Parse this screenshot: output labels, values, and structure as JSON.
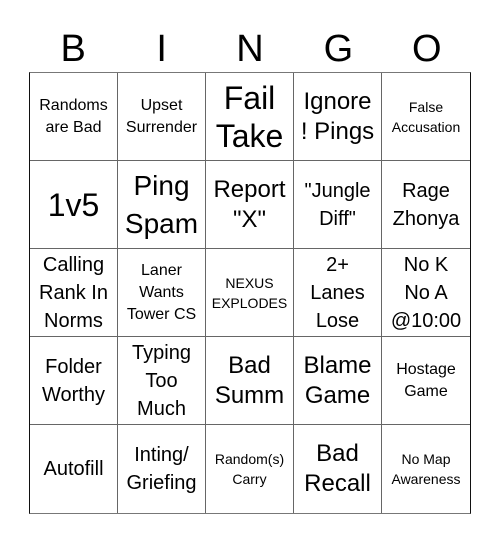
{
  "card": {
    "header": [
      "B",
      "I",
      "N",
      "G",
      "O"
    ],
    "cells": [
      {
        "text": "Randoms\nare Bad",
        "size": "s-sm"
      },
      {
        "text": "Upset\nSurrender",
        "size": "s-sm"
      },
      {
        "text": "Fail\nTake",
        "size": "s-xxl"
      },
      {
        "text": "Ignore\n! Pings",
        "size": "s-lg"
      },
      {
        "text": "False\nAccusation",
        "size": "s-xs"
      },
      {
        "text": "1v5",
        "size": "s-xxl"
      },
      {
        "text": "Ping\nSpam",
        "size": "s-xl"
      },
      {
        "text": "Report\n\"X\"",
        "size": "s-lg"
      },
      {
        "text": "\"Jungle\nDiff\"",
        "size": "s-md"
      },
      {
        "text": "Rage\nZhonya",
        "size": "s-md"
      },
      {
        "text": "Calling\nRank In\nNorms",
        "size": "s-md"
      },
      {
        "text": "Laner\nWants\nTower CS",
        "size": "s-sm"
      },
      {
        "text": "NEXUS\nEXPLODES",
        "size": "s-xs"
      },
      {
        "text": "2+\nLanes\nLose",
        "size": "s-md"
      },
      {
        "text": "No K\nNo A\n@10:00",
        "size": "s-md"
      },
      {
        "text": "Folder\nWorthy",
        "size": "s-md"
      },
      {
        "text": "Typing\nToo\nMuch",
        "size": "s-md"
      },
      {
        "text": "Bad\nSumm",
        "size": "s-lg"
      },
      {
        "text": "Blame\nGame",
        "size": "s-lg"
      },
      {
        "text": "Hostage\nGame",
        "size": "s-sm"
      },
      {
        "text": "Autofill",
        "size": "s-md"
      },
      {
        "text": "Inting/\nGriefing",
        "size": "s-md"
      },
      {
        "text": "Random(s)\nCarry",
        "size": "s-xs"
      },
      {
        "text": "Bad\nRecall",
        "size": "s-lg"
      },
      {
        "text": "No Map\nAwareness",
        "size": "s-xs"
      }
    ]
  }
}
